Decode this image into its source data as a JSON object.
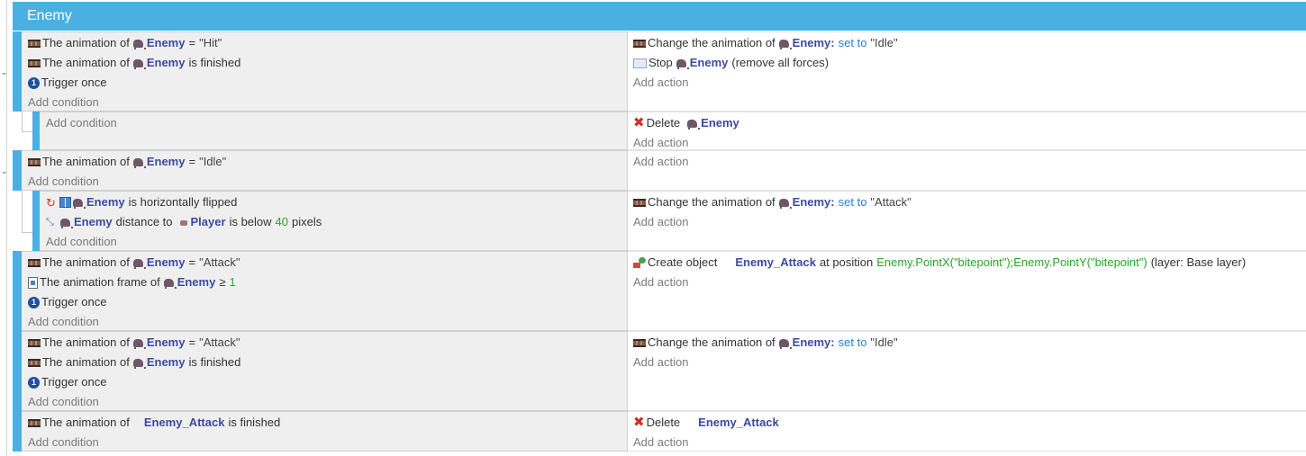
{
  "group": {
    "title": "Enemy"
  },
  "labels": {
    "the_animation_of": "The animation of",
    "add_condition": "Add condition",
    "add_action": "Add action",
    "trigger_once": "Trigger once",
    "is_finished": "is finished",
    "change_animation_of": "Change the animation of",
    "set_to": "set to",
    "delete": "Delete",
    "stop": "Stop",
    "remove_forces": "(remove all forces)",
    "is_horizontally_flipped": "is horizontally flipped",
    "distance_to": "distance to",
    "is_below": "is below",
    "pixels": "pixels",
    "animation_frame_of": "The animation frame of",
    "gte": "≥",
    "create_object": "Create object",
    "at_position": "at position",
    "eq": "="
  },
  "objects": {
    "enemy": "Enemy",
    "player": "Player",
    "enemy_attack": "Enemy_Attack"
  },
  "values": {
    "hit": "\"Hit\"",
    "idle": "\"Idle\"",
    "attack": "\"Attack\"",
    "distance": "40",
    "frame": "1",
    "enemy_colon": "Enemy:",
    "position_expr": "Enemy.PointX(\"bitepoint\");Enemy.PointY(\"bitepoint\")",
    "layer": "(layer: Base layer)"
  },
  "icons": {
    "animation": "animation-icon",
    "trigger": "trigger-once-icon",
    "enemy": "enemy-sprite-icon",
    "player": "player-sprite-icon",
    "stop": "stop-forces-icon",
    "delete": "delete-icon",
    "flip": "flip-icon",
    "distance": "distance-icon",
    "frame": "animation-frame-icon",
    "create": "create-object-icon"
  },
  "colors": {
    "group_bar": "#4ab0e4",
    "object_name": "#3c4aa0",
    "number": "#2aa52a",
    "keyword": "#2a80d0",
    "condition_bg": "#efefef"
  }
}
